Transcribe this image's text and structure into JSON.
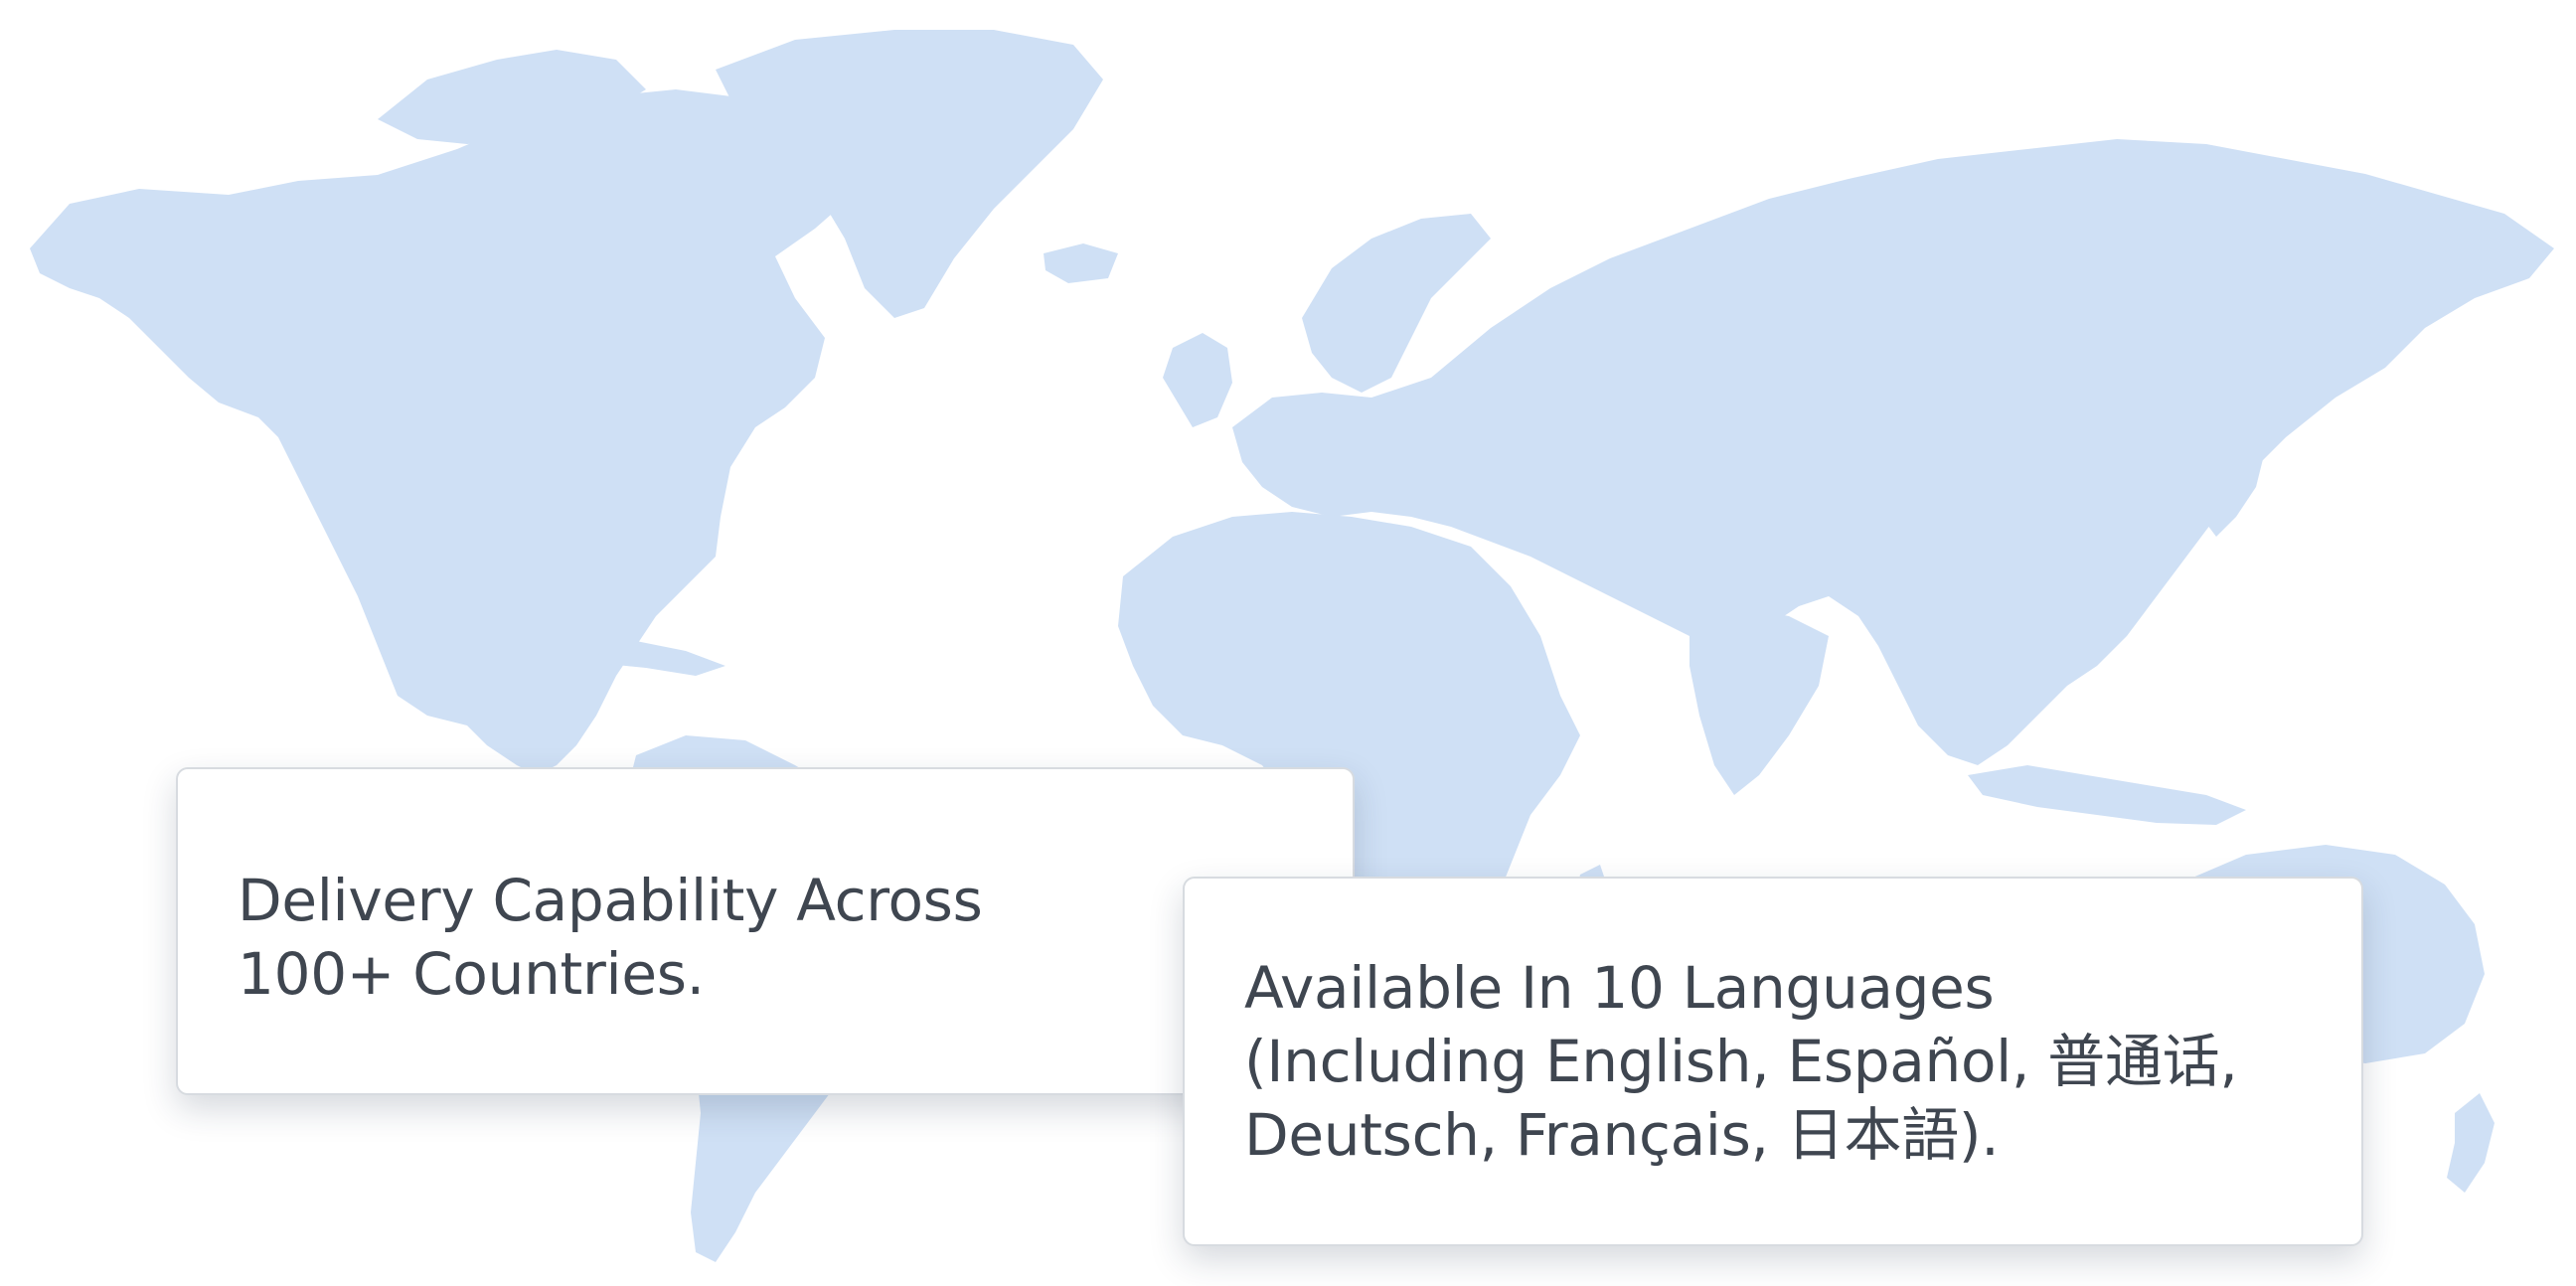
{
  "map": {
    "icon": "world-map-icon",
    "land_color": "#cfe0f5"
  },
  "cards": {
    "delivery": {
      "lines": [
        "Delivery Capability Across",
        "100+ Countries."
      ]
    },
    "languages": {
      "lines": [
        "Available In 10 Languages",
        "(Including English, Español, 普通话,",
        "Deutsch, Français, 日本語)."
      ]
    }
  }
}
